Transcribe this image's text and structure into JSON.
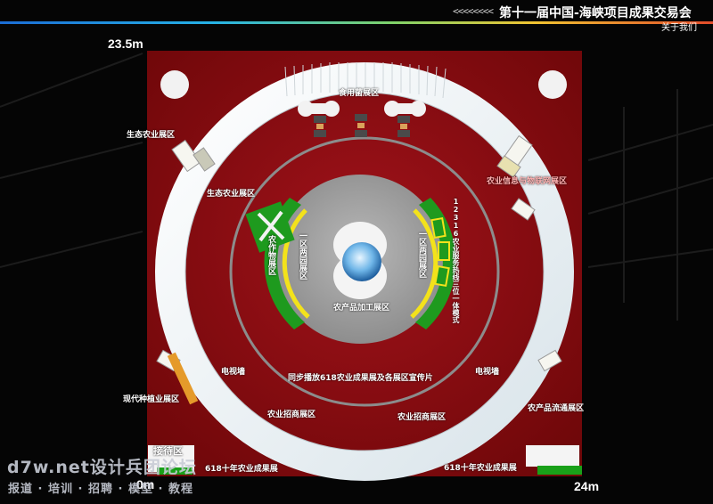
{
  "header": {
    "chevrons": "<<<<<<<<",
    "title": "第十一届中国-海峡项目成果交易会",
    "subtitle": "关于我们"
  },
  "dimensions": {
    "height_label": "23.5m",
    "origin_label": "0m",
    "width_label": "24m"
  },
  "zones": {
    "edible_fungi": "食用菌展区",
    "eco_agri_top": "生态农业展区",
    "eco_agri_inner": "生态农业展区",
    "agri_info": "农业信息与物联网展区",
    "crops": "农作物展区",
    "district_left": "一区两园展区",
    "district_right": "一区两园展区",
    "hotline": "12316农业服务热线三位一体模式",
    "processing": "农产品加工展区",
    "tv_wall_left": "电视墙",
    "tv_wall_right": "电视墙",
    "sync_play": "同步播放618农业成果展及各展区宣传片",
    "modern_planting": "现代种植业展区",
    "investment_left": "农业招商展区",
    "investment_right": "农业招商展区",
    "circulation": "农产品流通展区",
    "reception": "接待区",
    "tenyear_left": "618十年农业成果展",
    "tenyear_right": "618十年农业成果展"
  },
  "watermark": {
    "site": "d7w.net设计兵团论坛",
    "menu": "报道 · 培训 · 招聘 · 模型 · 教程"
  },
  "colors": {
    "floor": "#8e0a0e",
    "ring": "#eef3f6",
    "center": "#9a9a9a",
    "green": "#1e9a1e",
    "yellow": "#f3e21b"
  }
}
